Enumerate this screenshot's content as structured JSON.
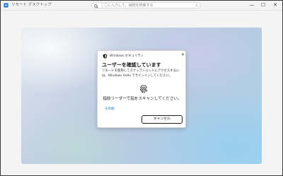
{
  "window": {
    "title": "リモート デスクトップ",
    "search_placeholder": "ここに入力して、接続を検索する",
    "minimize": "—",
    "maximize": "☐",
    "close": "✕"
  },
  "dialog": {
    "app_name": "Windows セキュリティ",
    "close": "✕",
    "title": "ユーザーを確認しています",
    "description": "リモートを使用してスナップショットにアクセスするには、Windows Hello でサインインしてください。",
    "fingerprint_prompt": "指紋リーダーで指をスキャンしてください。",
    "more_options": "その他",
    "cancel": "キャンセル"
  },
  "colors": {
    "accent": "#0067c0",
    "dialog_bg": "#ffffff",
    "titlebar_bg": "#f3f3f3"
  }
}
